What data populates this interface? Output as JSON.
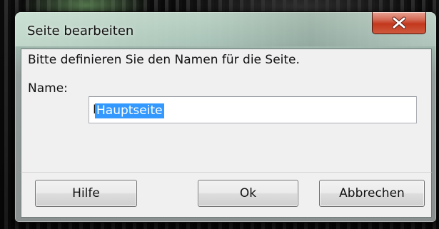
{
  "window": {
    "title": "Seite bearbeiten"
  },
  "dialog": {
    "prompt": "Bitte definieren Sie den Namen für die Seite.",
    "name_label": "Name:",
    "name_value": "Hauptseite"
  },
  "buttons": {
    "help_label": "Hilfe",
    "ok_label": "Ok",
    "cancel_label": "Abbrechen"
  },
  "icons": {
    "close": "close-icon"
  },
  "colors": {
    "close_button": "#c2381d",
    "selection": "#3399ff",
    "client_background": "#f0f0f0"
  }
}
